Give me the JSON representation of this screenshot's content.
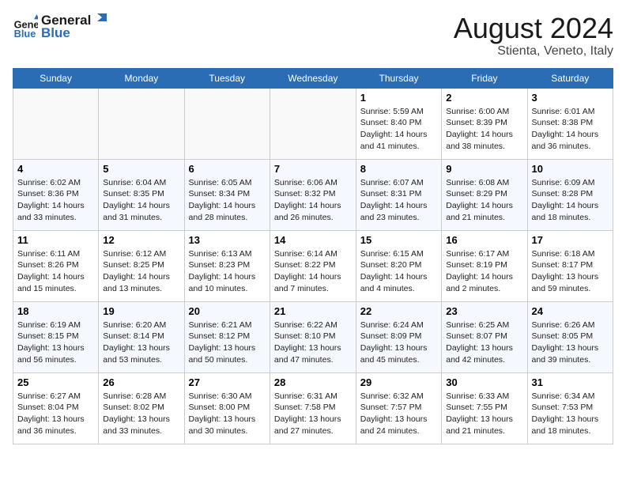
{
  "header": {
    "logo_line1": "General",
    "logo_line2": "Blue",
    "month_year": "August 2024",
    "location": "Stienta, Veneto, Italy"
  },
  "days_of_week": [
    "Sunday",
    "Monday",
    "Tuesday",
    "Wednesday",
    "Thursday",
    "Friday",
    "Saturday"
  ],
  "weeks": [
    [
      {
        "day": "",
        "info": ""
      },
      {
        "day": "",
        "info": ""
      },
      {
        "day": "",
        "info": ""
      },
      {
        "day": "",
        "info": ""
      },
      {
        "day": "1",
        "info": "Sunrise: 5:59 AM\nSunset: 8:40 PM\nDaylight: 14 hours\nand 41 minutes."
      },
      {
        "day": "2",
        "info": "Sunrise: 6:00 AM\nSunset: 8:39 PM\nDaylight: 14 hours\nand 38 minutes."
      },
      {
        "day": "3",
        "info": "Sunrise: 6:01 AM\nSunset: 8:38 PM\nDaylight: 14 hours\nand 36 minutes."
      }
    ],
    [
      {
        "day": "4",
        "info": "Sunrise: 6:02 AM\nSunset: 8:36 PM\nDaylight: 14 hours\nand 33 minutes."
      },
      {
        "day": "5",
        "info": "Sunrise: 6:04 AM\nSunset: 8:35 PM\nDaylight: 14 hours\nand 31 minutes."
      },
      {
        "day": "6",
        "info": "Sunrise: 6:05 AM\nSunset: 8:34 PM\nDaylight: 14 hours\nand 28 minutes."
      },
      {
        "day": "7",
        "info": "Sunrise: 6:06 AM\nSunset: 8:32 PM\nDaylight: 14 hours\nand 26 minutes."
      },
      {
        "day": "8",
        "info": "Sunrise: 6:07 AM\nSunset: 8:31 PM\nDaylight: 14 hours\nand 23 minutes."
      },
      {
        "day": "9",
        "info": "Sunrise: 6:08 AM\nSunset: 8:29 PM\nDaylight: 14 hours\nand 21 minutes."
      },
      {
        "day": "10",
        "info": "Sunrise: 6:09 AM\nSunset: 8:28 PM\nDaylight: 14 hours\nand 18 minutes."
      }
    ],
    [
      {
        "day": "11",
        "info": "Sunrise: 6:11 AM\nSunset: 8:26 PM\nDaylight: 14 hours\nand 15 minutes."
      },
      {
        "day": "12",
        "info": "Sunrise: 6:12 AM\nSunset: 8:25 PM\nDaylight: 14 hours\nand 13 minutes."
      },
      {
        "day": "13",
        "info": "Sunrise: 6:13 AM\nSunset: 8:23 PM\nDaylight: 14 hours\nand 10 minutes."
      },
      {
        "day": "14",
        "info": "Sunrise: 6:14 AM\nSunset: 8:22 PM\nDaylight: 14 hours\nand 7 minutes."
      },
      {
        "day": "15",
        "info": "Sunrise: 6:15 AM\nSunset: 8:20 PM\nDaylight: 14 hours\nand 4 minutes."
      },
      {
        "day": "16",
        "info": "Sunrise: 6:17 AM\nSunset: 8:19 PM\nDaylight: 14 hours\nand 2 minutes."
      },
      {
        "day": "17",
        "info": "Sunrise: 6:18 AM\nSunset: 8:17 PM\nDaylight: 13 hours\nand 59 minutes."
      }
    ],
    [
      {
        "day": "18",
        "info": "Sunrise: 6:19 AM\nSunset: 8:15 PM\nDaylight: 13 hours\nand 56 minutes."
      },
      {
        "day": "19",
        "info": "Sunrise: 6:20 AM\nSunset: 8:14 PM\nDaylight: 13 hours\nand 53 minutes."
      },
      {
        "day": "20",
        "info": "Sunrise: 6:21 AM\nSunset: 8:12 PM\nDaylight: 13 hours\nand 50 minutes."
      },
      {
        "day": "21",
        "info": "Sunrise: 6:22 AM\nSunset: 8:10 PM\nDaylight: 13 hours\nand 47 minutes."
      },
      {
        "day": "22",
        "info": "Sunrise: 6:24 AM\nSunset: 8:09 PM\nDaylight: 13 hours\nand 45 minutes."
      },
      {
        "day": "23",
        "info": "Sunrise: 6:25 AM\nSunset: 8:07 PM\nDaylight: 13 hours\nand 42 minutes."
      },
      {
        "day": "24",
        "info": "Sunrise: 6:26 AM\nSunset: 8:05 PM\nDaylight: 13 hours\nand 39 minutes."
      }
    ],
    [
      {
        "day": "25",
        "info": "Sunrise: 6:27 AM\nSunset: 8:04 PM\nDaylight: 13 hours\nand 36 minutes."
      },
      {
        "day": "26",
        "info": "Sunrise: 6:28 AM\nSunset: 8:02 PM\nDaylight: 13 hours\nand 33 minutes."
      },
      {
        "day": "27",
        "info": "Sunrise: 6:30 AM\nSunset: 8:00 PM\nDaylight: 13 hours\nand 30 minutes."
      },
      {
        "day": "28",
        "info": "Sunrise: 6:31 AM\nSunset: 7:58 PM\nDaylight: 13 hours\nand 27 minutes."
      },
      {
        "day": "29",
        "info": "Sunrise: 6:32 AM\nSunset: 7:57 PM\nDaylight: 13 hours\nand 24 minutes."
      },
      {
        "day": "30",
        "info": "Sunrise: 6:33 AM\nSunset: 7:55 PM\nDaylight: 13 hours\nand 21 minutes."
      },
      {
        "day": "31",
        "info": "Sunrise: 6:34 AM\nSunset: 7:53 PM\nDaylight: 13 hours\nand 18 minutes."
      }
    ]
  ]
}
